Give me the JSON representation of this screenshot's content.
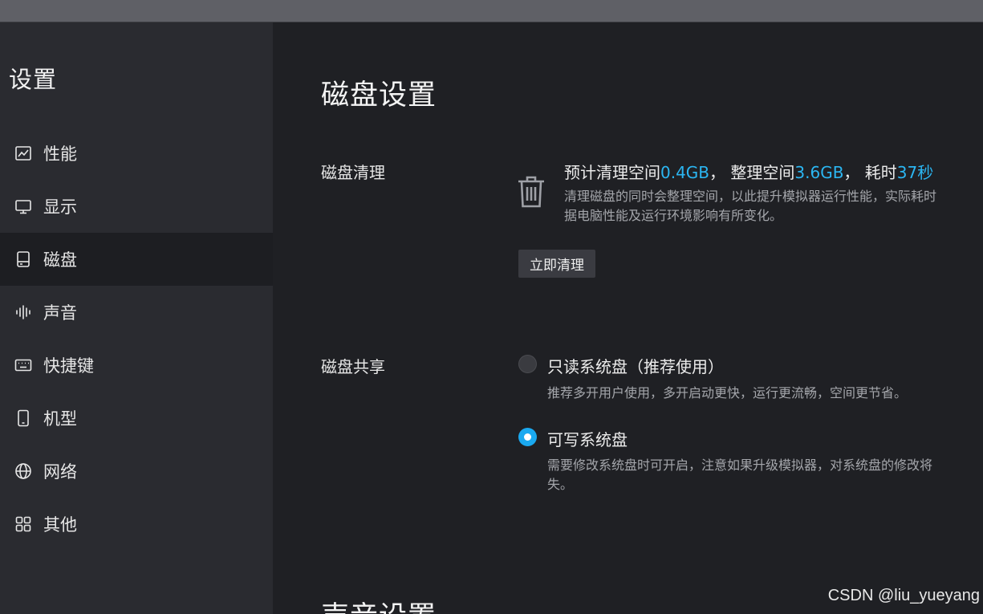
{
  "sidebar": {
    "title": "设置",
    "items": [
      {
        "label": "性能",
        "icon": "chart-icon"
      },
      {
        "label": "显示",
        "icon": "monitor-icon"
      },
      {
        "label": "磁盘",
        "icon": "disk-icon",
        "active": true
      },
      {
        "label": "声音",
        "icon": "sound-wave-icon"
      },
      {
        "label": "快捷键",
        "icon": "keyboard-icon"
      },
      {
        "label": "机型",
        "icon": "phone-icon"
      },
      {
        "label": "网络",
        "icon": "globe-icon"
      },
      {
        "label": "其他",
        "icon": "grid-icon"
      }
    ]
  },
  "main": {
    "title": "磁盘设置",
    "cleanup": {
      "label": "磁盘清理",
      "prefix": "预计清理空间",
      "clean_size": "0.4GB",
      "sep1": "， 整理空间",
      "organize_size": "3.6GB",
      "sep2": "， 耗时",
      "duration": "37秒",
      "desc_line1": "清理磁盘的同时会整理空间，以此提升模拟器运行性能，实际耗时",
      "desc_line2": "据电脑性能及运行环境影响有所变化。",
      "button": "立即清理"
    },
    "share": {
      "label": "磁盘共享",
      "options": [
        {
          "label": "只读系统盘（推荐使用）",
          "desc_line1": "推荐多开用户使用，多开启动更快，运行更流畅，空间更节省。",
          "selected": false
        },
        {
          "label": "可写系统盘",
          "desc_line1": "需要修改系统盘时可开启，注意如果升级模拟器，对系统盘的修改将",
          "desc_line2": "失。",
          "selected": true
        }
      ]
    },
    "next_section_title": "声音设置"
  },
  "watermark": "CSDN @liu_yueyang",
  "colors": {
    "accent": "#1aa9f0",
    "highlight_text": "#2bb6f2",
    "sidebar_bg": "#2a2b30",
    "main_bg": "#1f2024"
  }
}
